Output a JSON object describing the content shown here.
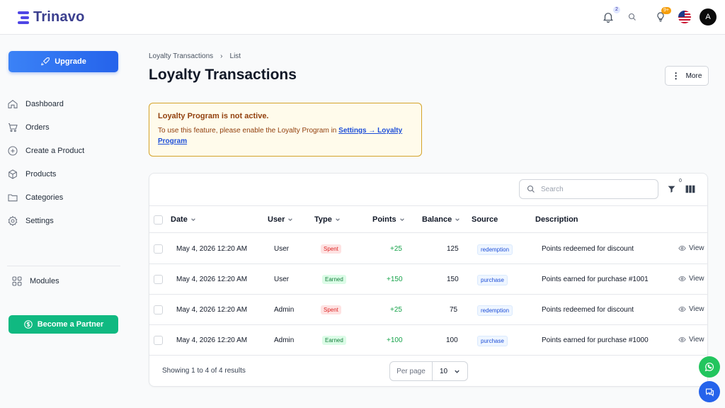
{
  "brand": {
    "name": "Trinavo"
  },
  "header": {
    "notifications_count": "2",
    "ideas_count": "9+",
    "avatar_initial": "A"
  },
  "sidebar": {
    "upgrade_label": "Upgrade",
    "items": [
      {
        "label": "Dashboard",
        "icon": "home-icon"
      },
      {
        "label": "Orders",
        "icon": "cart-icon"
      },
      {
        "label": "Create a Product",
        "icon": "plus-circle-icon"
      },
      {
        "label": "Products",
        "icon": "box-icon"
      },
      {
        "label": "Categories",
        "icon": "folder-icon"
      },
      {
        "label": "Settings",
        "icon": "gear-icon"
      }
    ],
    "modules_label": "Modules",
    "partner_label": "Become a Partner"
  },
  "breadcrumb": {
    "parent": "Loyalty Transactions",
    "current": "List"
  },
  "page": {
    "title": "Loyalty Transactions",
    "more_label": "More"
  },
  "alert": {
    "title": "Loyalty Program is not active.",
    "body_prefix": "To use this feature, please enable the Loyalty Program in ",
    "link_part1": "Settings → Loyalty",
    "link_part2": "Program"
  },
  "table": {
    "search_placeholder": "Search",
    "filter_count": "0",
    "columns": {
      "date": "Date",
      "user": "User",
      "type": "Type",
      "points": "Points",
      "balance": "Balance",
      "source": "Source",
      "description": "Description"
    },
    "rows": [
      {
        "date": "May 4, 2026 12:20 AM",
        "user": "User",
        "type": "Spent",
        "points": "+25",
        "balance": "125",
        "source": "redemption",
        "description": "Points redeemed for discount",
        "action": "View"
      },
      {
        "date": "May 4, 2026 12:20 AM",
        "user": "User",
        "type": "Earned",
        "points": "+150",
        "balance": "150",
        "source": "purchase",
        "description": "Points earned for purchase #1001",
        "action": "View"
      },
      {
        "date": "May 4, 2026 12:20 AM",
        "user": "Admin",
        "type": "Spent",
        "points": "+25",
        "balance": "75",
        "source": "redemption",
        "description": "Points redeemed for discount",
        "action": "View"
      },
      {
        "date": "May 4, 2026 12:20 AM",
        "user": "Admin",
        "type": "Earned",
        "points": "+100",
        "balance": "100",
        "source": "purchase",
        "description": "Points earned for purchase #1000",
        "action": "View"
      }
    ],
    "showing": "Showing 1 to 4 of 4 results",
    "per_page_label": "Per page",
    "per_page_value": "10"
  },
  "colors": {
    "accent": "#2563eb",
    "partner": "#10b981",
    "whatsapp": "#22c55e"
  }
}
